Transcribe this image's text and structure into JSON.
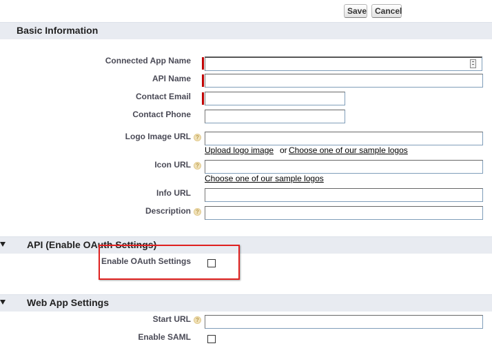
{
  "toolbar": {
    "save_label": "Save",
    "cancel_label": "Cancel"
  },
  "sections": {
    "basic_info": "Basic Information",
    "api_oauth": "API (Enable OAuth Settings)",
    "web_app": "Web App Settings"
  },
  "fields": {
    "connected_app_name": {
      "label": "Connected App Name",
      "value": "",
      "required": true
    },
    "api_name": {
      "label": "API Name",
      "value": "",
      "required": true
    },
    "contact_email": {
      "label": "Contact Email",
      "value": "",
      "required": true
    },
    "contact_phone": {
      "label": "Contact Phone",
      "value": ""
    },
    "logo_image_url": {
      "label": "Logo Image URL",
      "value": ""
    },
    "icon_url": {
      "label": "Icon URL",
      "value": ""
    },
    "info_url": {
      "label": "Info URL",
      "value": ""
    },
    "description": {
      "label": "Description",
      "value": ""
    },
    "enable_oauth": {
      "label": "Enable OAuth Settings",
      "checked": false
    },
    "start_url": {
      "label": "Start URL",
      "value": ""
    },
    "enable_saml": {
      "label": "Enable SAML",
      "checked": false
    }
  },
  "links": {
    "upload_logo": "Upload logo image",
    "or_text": "or",
    "choose_sample_logos": "Choose one of our sample logos",
    "choose_sample_logos_icon": "Choose one of our sample logos"
  },
  "colors": {
    "required_marker": "#c00000",
    "highlight_border": "#e0201f",
    "section_bar": "#e8ebf1"
  }
}
